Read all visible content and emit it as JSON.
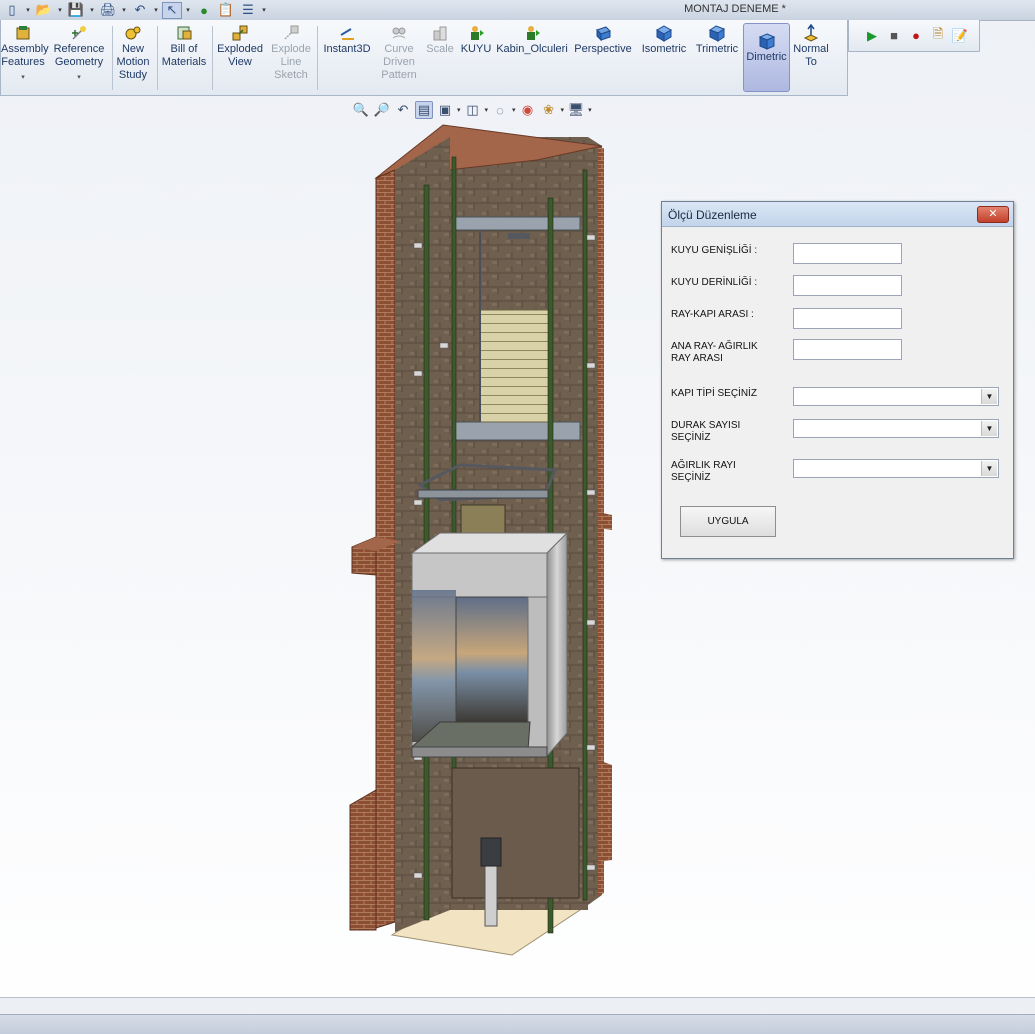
{
  "window": {
    "title": "MONTAJ DENEME *"
  },
  "quick_access": {
    "icons": [
      "new-document-icon",
      "open-folder-icon",
      "save-icon",
      "print-icon",
      "undo-icon",
      "select-arrow-icon",
      "rebuild-traffic-light-icon",
      "file-properties-icon",
      "options-list-icon"
    ]
  },
  "command_manager": {
    "items": [
      {
        "label_1": "Assembly",
        "label_2": "Features",
        "icon": "assembly-features-icon",
        "dropdown": true,
        "enabled": true
      },
      {
        "label_1": "Reference",
        "label_2": "Geometry",
        "icon": "reference-geometry-icon",
        "dropdown": true,
        "enabled": true
      },
      {
        "label_1": "New",
        "label_2": "Motion",
        "label_3": "Study",
        "icon": "motion-study-icon",
        "enabled": true
      },
      {
        "label_1": "Bill of",
        "label_2": "Materials",
        "icon": "bill-of-materials-icon",
        "enabled": true
      },
      {
        "label_1": "Exploded",
        "label_2": "View",
        "icon": "exploded-view-icon",
        "enabled": true
      },
      {
        "label_1": "Explode",
        "label_2": "Line",
        "label_3": "Sketch",
        "icon": "explode-line-sketch-icon",
        "enabled": false
      },
      {
        "label_1": "Instant3D",
        "icon": "instant3d-icon",
        "enabled": true
      },
      {
        "label_1": "Curve",
        "label_2": "Driven",
        "label_3": "Pattern",
        "icon": "curve-driven-pattern-icon",
        "enabled": false
      },
      {
        "label_1": "Scale",
        "icon": "scale-icon",
        "enabled": false
      },
      {
        "label_1": "KUYU",
        "icon": "macro-kuyu-icon",
        "enabled": true
      },
      {
        "label_1": "Kabin_Olculeri",
        "icon": "macro-kabin-olculeri-icon",
        "enabled": true
      },
      {
        "label_1": "Perspective",
        "icon": "perspective-icon",
        "enabled": true
      },
      {
        "label_1": "Isometric",
        "icon": "isometric-icon",
        "enabled": true
      },
      {
        "label_1": "Trimetric",
        "icon": "trimetric-icon",
        "enabled": true
      },
      {
        "label_1": "Dimetric",
        "icon": "dimetric-icon",
        "enabled": true,
        "active": true
      },
      {
        "label_1": "Normal",
        "label_2": "To",
        "icon": "normal-to-icon",
        "enabled": true
      }
    ]
  },
  "macro_toolbar": {
    "icons": [
      "run-macro-icon",
      "stop-macro-icon",
      "record-macro-icon",
      "new-macro-icon",
      "edit-macro-icon"
    ]
  },
  "view_toolbar": {
    "icons": [
      "zoom-to-fit-icon",
      "zoom-to-area-icon",
      "previous-view-icon",
      "section-view-icon",
      "view-orientation-icon",
      "display-style-icon",
      "hide-show-items-icon",
      "edit-appearance-icon",
      "apply-scene-icon",
      "view-settings-icon"
    ]
  },
  "dialog": {
    "title": "Ölçü Düzenleme",
    "close_symbol": "✕",
    "fields": [
      {
        "label": "KUYU GENİŞLİĞİ  :",
        "value": ""
      },
      {
        "label": "KUYU DERİNLİĞİ :",
        "value": ""
      },
      {
        "label": "RAY-KAPI ARASI :",
        "value": ""
      },
      {
        "label_1": "ANA RAY- AĞIRLIK",
        "label_2": "RAY ARASI",
        "value": ""
      }
    ],
    "selects": [
      {
        "label_1": "KAPI TİPİ SEÇİNİZ",
        "label_2": "",
        "value": ""
      },
      {
        "label_1": "DURAK SAYISI",
        "label_2": "SEÇİNİZ",
        "value": ""
      },
      {
        "label_1": "AĞIRLIK RAYI",
        "label_2": "SEÇİNİZ",
        "value": ""
      }
    ],
    "apply_label": "UYGULA"
  },
  "colors": {
    "brick": "#8a4a2e",
    "stone_wall": "#6e5e4c",
    "rail": "#3c5a2e",
    "cabin_frame": "#b8b8b8",
    "floor": "#f1e3c4",
    "active_view": "#aeb8e0"
  }
}
